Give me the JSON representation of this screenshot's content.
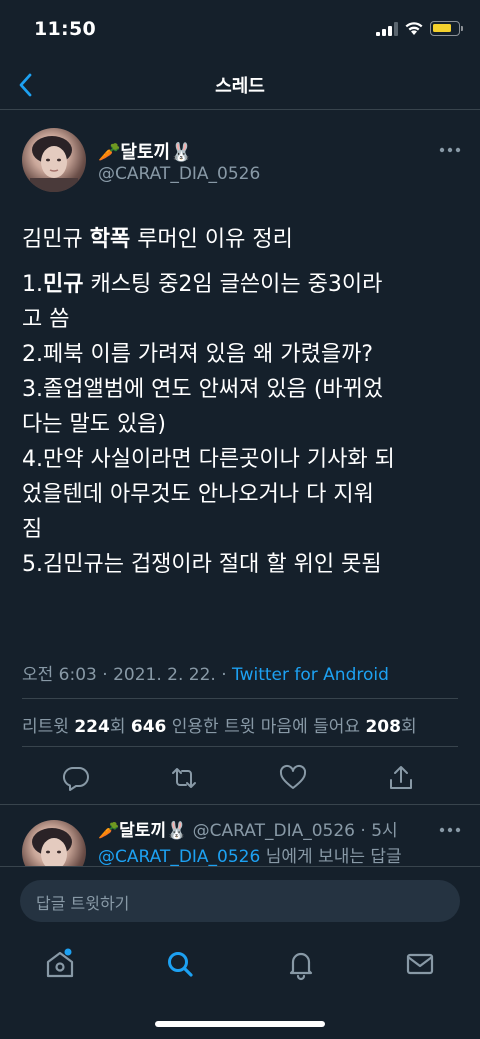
{
  "status_bar": {
    "time": "11:50"
  },
  "nav": {
    "title": "스레드"
  },
  "tweet": {
    "display_name": "🥕달토끼🐰",
    "handle": "@CARAT_DIA_0526",
    "paragraphs": [
      [
        {
          "t": "김민규 "
        },
        {
          "t": "학폭",
          "b": true
        },
        {
          "t": " 루머인 이유 정리"
        }
      ],
      [
        {
          "t": "1."
        },
        {
          "t": "민규",
          "b": true
        },
        {
          "t": " 캐스팅 중2임 글쓴이는 중3이라\n고 씀"
        }
      ],
      [
        {
          "t": "2.페북 이름 가려져 있음 왜 가렸을까?"
        }
      ],
      [
        {
          "t": "3.졸업앨범에 연도 안써져 있음 (바뀌었\n다는 말도 있음)"
        }
      ],
      [
        {
          "t": "4.만약 사실이라면 다른곳이나 기사화 되\n었을텐데 아무것도 안나오거나 다 지워\n짐"
        }
      ],
      [
        {
          "t": "5.김민규는 겁쟁이라 절대 할 위인 못됨"
        }
      ]
    ],
    "meta_time": "오전 6:03 · 2021. 2. 22. · ",
    "source": "Twitter for Android",
    "retweets_label": "리트윗 ",
    "retweets": "224",
    "retweets_suffix": "회  ",
    "quotes": "646",
    "quotes_label": " 인용한 트윗  ",
    "likes_label": "마음에 들어요 ",
    "likes": "208",
    "likes_suffix": "회"
  },
  "reply": {
    "display_name": "🥕달토끼🐰",
    "handle_time": " @CARAT_DIA_0526 · 5시",
    "reply_mention": "@CARAT_DIA_0526",
    "reply_suffix": " 님에게 보내는 답글"
  },
  "compose": {
    "placeholder": "답글 트윗하기"
  },
  "colors": {
    "background": "#15202b",
    "accent": "#1da1f2",
    "muted": "#8899a6",
    "divider": "#38444d"
  },
  "icons": [
    "back-icon",
    "more-icon",
    "reply-icon",
    "retweet-icon",
    "like-icon",
    "share-icon",
    "home-icon",
    "search-icon",
    "notifications-icon",
    "messages-icon"
  ]
}
